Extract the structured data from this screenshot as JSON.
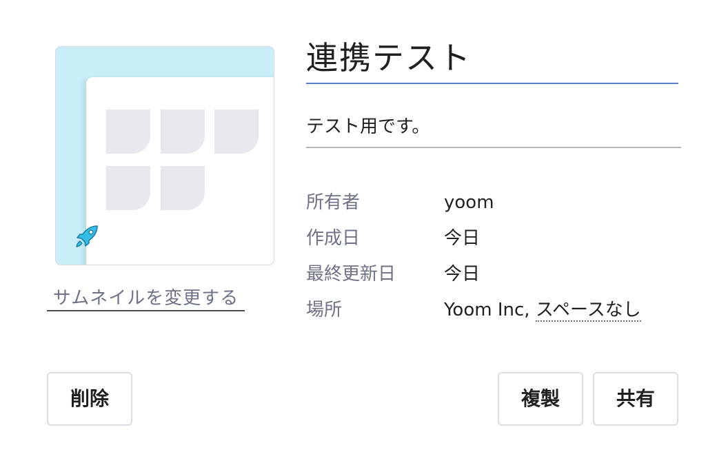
{
  "thumbnail": {
    "change_label": "サムネイルを変更する"
  },
  "project": {
    "title": "連携テスト",
    "description": "テスト用です。"
  },
  "meta": {
    "owner_label": "所有者",
    "owner_value": "yoom",
    "created_label": "作成日",
    "created_value": "今日",
    "updated_label": "最終更新日",
    "updated_value": "今日",
    "location_label": "場所",
    "location_org": "Yoom Inc,",
    "location_space": "スペースなし"
  },
  "actions": {
    "delete_label": "削除",
    "duplicate_label": "複製",
    "share_label": "共有"
  },
  "colors": {
    "thumbnail_bg": "#c9eef8",
    "title_underline": "#5b7fd0",
    "rocket": "#35bde6"
  },
  "icons": {
    "thumbnail_icon": "rocket-icon"
  }
}
